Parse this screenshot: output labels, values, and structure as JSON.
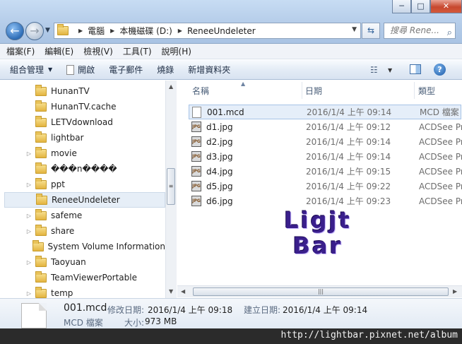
{
  "window": {
    "minimize": "─",
    "maximize": "□",
    "close": "✕"
  },
  "navigation": {
    "back_glyph": "←",
    "forward_glyph": "→"
  },
  "address": {
    "crumbs": [
      "電腦",
      "本機磁碟 (D:)",
      "ReneeUndeleter"
    ]
  },
  "search": {
    "placeholder": "搜尋 Rene..."
  },
  "menu": [
    "檔案(F)",
    "編輯(E)",
    "檢視(V)",
    "工具(T)",
    "說明(H)"
  ],
  "commands": {
    "organize": "組合管理",
    "open": "開啟",
    "email": "電子郵件",
    "burn": "燒錄",
    "new_folder": "新增資料夾",
    "help": "?"
  },
  "nav_pane": {
    "items": [
      {
        "label": "HunanTV",
        "expandable": false
      },
      {
        "label": "HunanTV.cache",
        "expandable": false
      },
      {
        "label": "LETVdownload",
        "expandable": false
      },
      {
        "label": "lightbar",
        "expandable": false
      },
      {
        "label": "movie",
        "expandable": true
      },
      {
        "label": "���n����",
        "expandable": false
      },
      {
        "label": "ppt",
        "expandable": true
      },
      {
        "label": "ReneeUndeleter",
        "expandable": false,
        "selected": true
      },
      {
        "label": "safeme",
        "expandable": true
      },
      {
        "label": "share",
        "expandable": true
      },
      {
        "label": "System Volume Information",
        "expandable": false
      },
      {
        "label": "Taoyuan",
        "expandable": true
      },
      {
        "label": "TeamViewerPortable",
        "expandable": false
      },
      {
        "label": "temp",
        "expandable": true
      }
    ]
  },
  "file_list": {
    "columns": {
      "name": "名稱",
      "date": "日期",
      "type": "類型"
    },
    "rows": [
      {
        "name": "001.mcd",
        "date": "2016/1/4 上午 09:14",
        "type": "MCD 檔案",
        "icon": "mcd-file-icon",
        "selected": true
      },
      {
        "name": "d1.jpg",
        "date": "2016/1/4 上午 09:12",
        "type": "ACDSee Pro",
        "icon": "jpg-file-icon"
      },
      {
        "name": "d2.jpg",
        "date": "2016/1/4 上午 09:14",
        "type": "ACDSee Pro",
        "icon": "jpg-file-icon"
      },
      {
        "name": "d3.jpg",
        "date": "2016/1/4 上午 09:14",
        "type": "ACDSee Pro",
        "icon": "jpg-file-icon"
      },
      {
        "name": "d4.jpg",
        "date": "2016/1/4 上午 09:15",
        "type": "ACDSee Pro",
        "icon": "jpg-file-icon"
      },
      {
        "name": "d5.jpg",
        "date": "2016/1/4 上午 09:22",
        "type": "ACDSee Pro",
        "icon": "jpg-file-icon"
      },
      {
        "name": "d6.jpg",
        "date": "2016/1/4 上午 09:23",
        "type": "ACDSee Pro",
        "icon": "jpg-file-icon"
      }
    ]
  },
  "watermark": {
    "line1": "Ligjt",
    "line2": "Bar",
    "color": "#3a1f8c"
  },
  "details": {
    "name": "001.mcd",
    "type": "MCD 檔案",
    "modified_label": "修改日期:",
    "modified_value": "2016/1/4 上午 09:18",
    "created_label": "建立日期:",
    "created_value": "2016/1/4 上午 09:14",
    "size_label": "大小:",
    "size_value": "973 MB"
  },
  "footer": {
    "url": "http://lightbar.pixnet.net/album"
  },
  "colors": {
    "selection": "#e5eef9",
    "chrome": "#b3cbe8"
  }
}
